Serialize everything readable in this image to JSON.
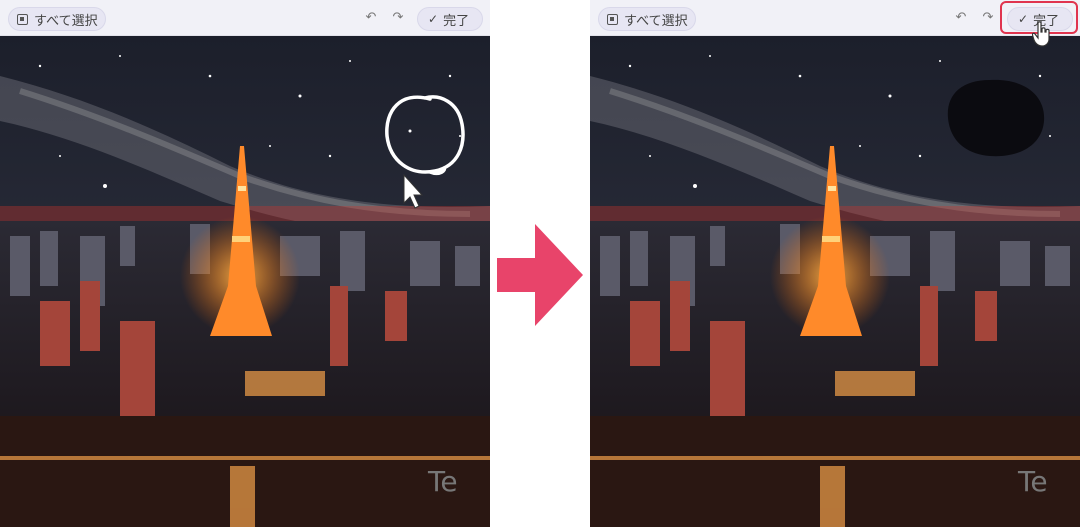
{
  "toolbar": {
    "select_all_label": "すべて選択",
    "undo_icon": "undo-icon",
    "redo_icon": "redo-icon",
    "done_label": "完了",
    "check_glyph": "✓"
  },
  "watermark": "Te",
  "colors": {
    "arrow": "#e8446a",
    "highlight": "#e0344e",
    "sky_top": "#1b1d29",
    "city_glow": "#f06a2a"
  }
}
